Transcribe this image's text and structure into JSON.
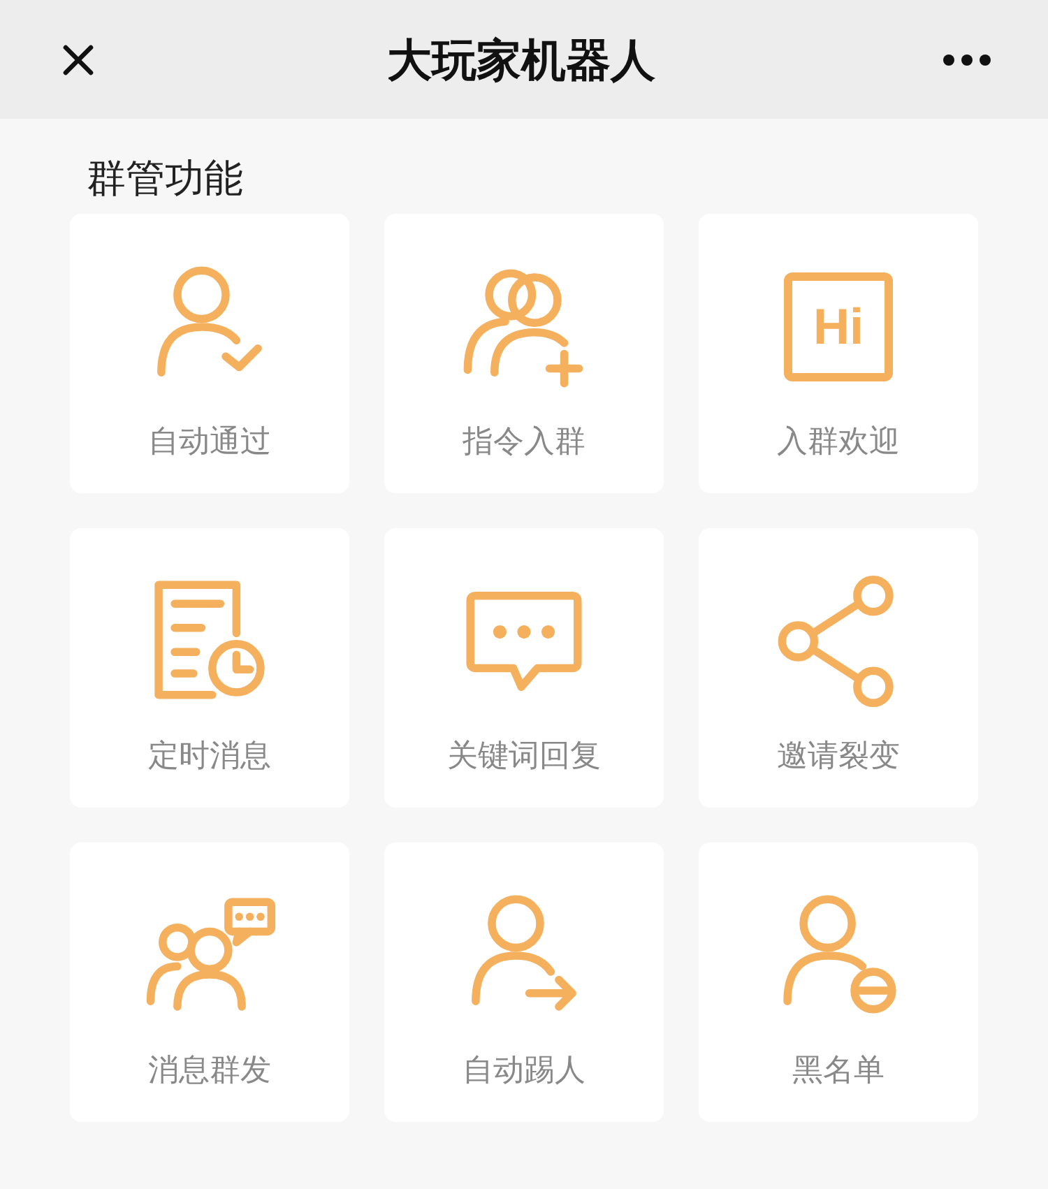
{
  "header": {
    "title": "大玩家机器人"
  },
  "section": {
    "title": "群管功能"
  },
  "welcome_icon": {
    "text": "Hi"
  },
  "features": [
    {
      "label": "自动通过"
    },
    {
      "label": "指令入群"
    },
    {
      "label": "入群欢迎"
    },
    {
      "label": "定时消息"
    },
    {
      "label": "关键词回复"
    },
    {
      "label": "邀请裂变"
    },
    {
      "label": "消息群发"
    },
    {
      "label": "自动踢人"
    },
    {
      "label": "黑名单"
    }
  ]
}
